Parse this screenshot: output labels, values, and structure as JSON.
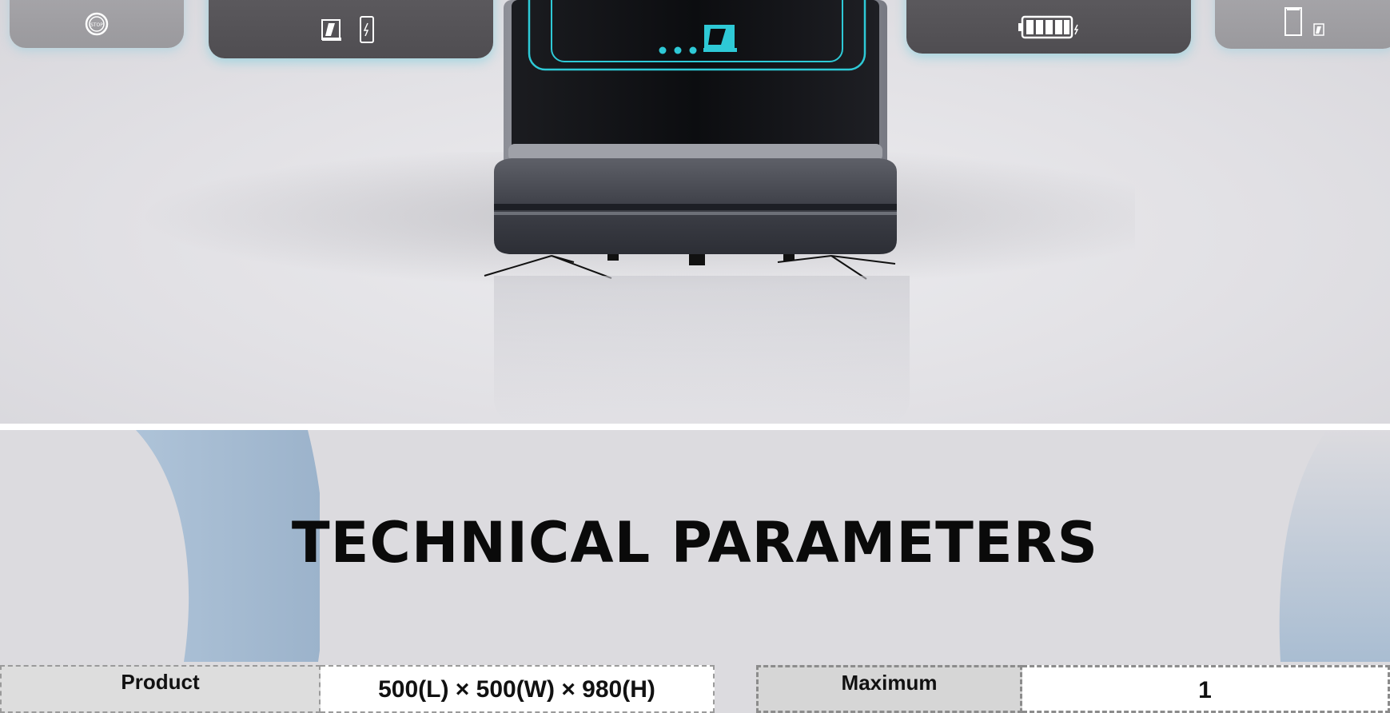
{
  "hero": {
    "cards": [
      {
        "id": "far-left",
        "icon": "stop-button-icon",
        "icon_text": "STOP"
      },
      {
        "id": "left",
        "icons": [
          "robot-icon",
          "charging-phone-icon"
        ]
      },
      {
        "id": "right",
        "icons": [
          "battery-full-icon"
        ]
      },
      {
        "id": "far-right",
        "icons": [
          "door-icon",
          "robot-small-icon"
        ]
      }
    ],
    "screen_accent": "#2ec9d6"
  },
  "technical": {
    "title": "TECHNICAL PARAMETERS",
    "rows": [
      {
        "label": "Product",
        "value": "500(L) × 500(W) × 980(H)"
      },
      {
        "label": "Maximum",
        "value": "1"
      }
    ],
    "colors": {
      "accent_blue": "#a6bbd2",
      "title": "#0a0a0a"
    }
  }
}
